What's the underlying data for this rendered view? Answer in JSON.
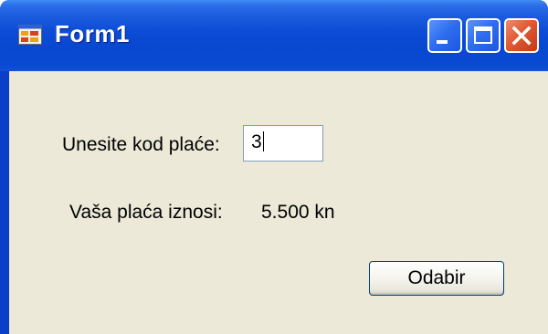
{
  "window": {
    "title": "Form1",
    "controls": {
      "minimize": "minimize-icon",
      "maximize": "maximize-icon",
      "close": "close-icon"
    },
    "colors": {
      "titlebar": "#0c4cd6",
      "client_background": "#ece9d8",
      "close_button": "#e05a34"
    }
  },
  "form": {
    "code_label": "Unesite kod plaće:",
    "code_value": "3",
    "result_label": "Vaša plaća iznosi:",
    "result_value": "5.500 kn",
    "submit_label": "Odabir"
  }
}
